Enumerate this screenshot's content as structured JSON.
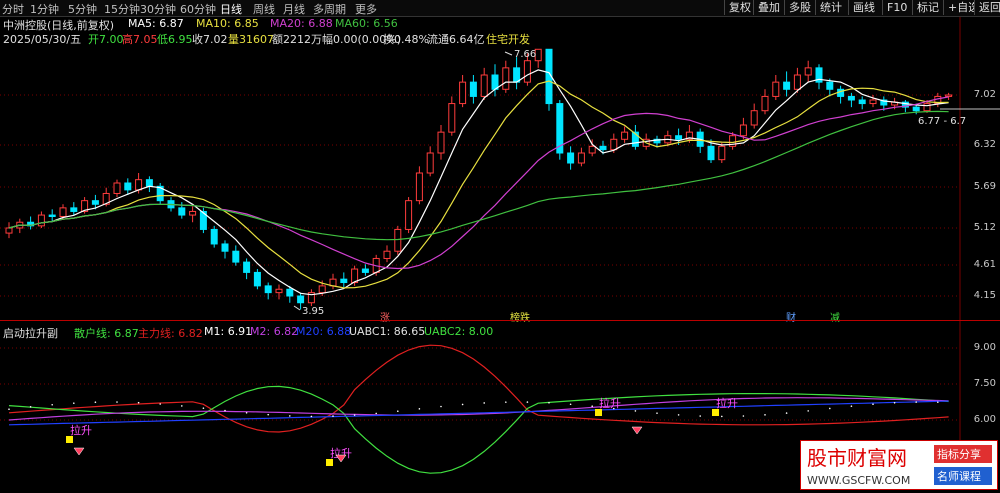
{
  "toolbar": {
    "tabs": [
      "分时",
      "1分钟",
      "5分钟",
      "15分钟",
      "30分钟",
      "60分钟",
      "日线",
      "周线",
      "月线",
      "多周期",
      "更多"
    ],
    "active": "日线",
    "right_buttons": [
      "复权",
      "叠加",
      "多股",
      "统计",
      "画线",
      "F10",
      "标记",
      "+自选",
      "返回"
    ]
  },
  "header": {
    "name": "中洲控股(日线,前复权)",
    "ma5": "MA5: 6.87",
    "ma10": "MA10: 6.85",
    "ma20": "MA20: 6.88",
    "ma60": "MA60: 6.56",
    "date": "2025/05/30/五",
    "open": "开7.00",
    "high": "高7.05",
    "low": "低6.95",
    "close": "收7.02",
    "vol": "量31607",
    "amt": "额2212万",
    "chg": "幅0.00(0.00%)",
    "turnover": "换0.48%",
    "float": "流通6.64亿",
    "sector": "住宅开发"
  },
  "indicator_header": {
    "name": "启动拉升副",
    "retail": "散户线: 6.87",
    "main": "主力线: 6.82",
    "m1": "M1: 6.91",
    "m2": "M2: 6.82",
    "m20": "M20: 6.88",
    "uabc1": "UABC1: 86.65",
    "uabc2": "UABC2: 8.00"
  },
  "colors": {
    "up": "#ff3c3c",
    "down": "#00e5ff",
    "ma5": "#ffffff",
    "ma10": "#e8e040",
    "ma20": "#d040d0",
    "ma60": "#40c040",
    "retail": "#40e040",
    "main": "#e02020",
    "m1": "#ffffff",
    "m2": "#c040e0",
    "m20": "#2040ff"
  },
  "chart_data": {
    "type": "candlestick",
    "price_axis": {
      "ticks": [
        "7.02",
        "6.32",
        "5.69",
        "5.12",
        "4.61",
        "4.15"
      ]
    },
    "indicator_axis": {
      "ticks": [
        "9.00",
        "7.50",
        "6.00"
      ]
    },
    "annotations": {
      "high": "7.66",
      "low": "3.95",
      "right_label": "6.77 - 6.7",
      "tag_zhang": "涨",
      "tag_bangdie": "榜跌",
      "tag_cai": "财",
      "tag_jian": "减",
      "lasheng": "拉升"
    },
    "candles": [
      [
        5.05,
        5.12,
        4.98,
        5.2
      ],
      [
        5.12,
        5.2,
        5.05,
        5.25
      ],
      [
        5.2,
        5.15,
        5.1,
        5.28
      ],
      [
        5.15,
        5.3,
        5.12,
        5.35
      ],
      [
        5.3,
        5.28,
        5.2,
        5.38
      ],
      [
        5.28,
        5.4,
        5.25,
        5.45
      ],
      [
        5.4,
        5.35,
        5.3,
        5.48
      ],
      [
        5.35,
        5.5,
        5.32,
        5.55
      ],
      [
        5.5,
        5.45,
        5.38,
        5.58
      ],
      [
        5.45,
        5.6,
        5.42,
        5.68
      ],
      [
        5.6,
        5.75,
        5.55,
        5.8
      ],
      [
        5.75,
        5.65,
        5.58,
        5.82
      ],
      [
        5.65,
        5.8,
        5.6,
        5.9
      ],
      [
        5.8,
        5.7,
        5.62,
        5.85
      ],
      [
        5.7,
        5.5,
        5.45,
        5.75
      ],
      [
        5.5,
        5.4,
        5.35,
        5.55
      ],
      [
        5.4,
        5.3,
        5.25,
        5.48
      ],
      [
        5.3,
        5.35,
        5.2,
        5.42
      ],
      [
        5.35,
        5.1,
        5.05,
        5.4
      ],
      [
        5.1,
        4.9,
        4.85,
        5.15
      ],
      [
        4.9,
        4.8,
        4.7,
        4.95
      ],
      [
        4.8,
        4.65,
        4.6,
        4.88
      ],
      [
        4.65,
        4.5,
        4.4,
        4.7
      ],
      [
        4.5,
        4.3,
        4.25,
        4.55
      ],
      [
        4.3,
        4.2,
        4.1,
        4.35
      ],
      [
        4.2,
        4.25,
        4.1,
        4.32
      ],
      [
        4.25,
        4.15,
        4.05,
        4.3
      ],
      [
        4.15,
        4.05,
        3.95,
        4.2
      ],
      [
        4.05,
        4.2,
        4.0,
        4.25
      ],
      [
        4.2,
        4.3,
        4.15,
        4.38
      ],
      [
        4.3,
        4.4,
        4.25,
        4.48
      ],
      [
        4.4,
        4.35,
        4.28,
        4.5
      ],
      [
        4.35,
        4.55,
        4.3,
        4.6
      ],
      [
        4.55,
        4.5,
        4.45,
        4.62
      ],
      [
        4.5,
        4.7,
        4.45,
        4.75
      ],
      [
        4.7,
        4.8,
        4.65,
        4.88
      ],
      [
        4.8,
        5.1,
        4.75,
        5.15
      ],
      [
        5.1,
        5.5,
        5.05,
        5.55
      ],
      [
        5.5,
        5.9,
        5.45,
        6.0
      ],
      [
        5.9,
        6.2,
        5.85,
        6.3
      ],
      [
        6.2,
        6.5,
        6.1,
        6.6
      ],
      [
        6.5,
        6.9,
        6.45,
        7.0
      ],
      [
        6.9,
        7.2,
        6.85,
        7.3
      ],
      [
        7.2,
        7.0,
        6.9,
        7.3
      ],
      [
        7.0,
        7.3,
        6.95,
        7.4
      ],
      [
        7.3,
        7.1,
        7.0,
        7.45
      ],
      [
        7.1,
        7.4,
        7.05,
        7.5
      ],
      [
        7.4,
        7.2,
        7.1,
        7.55
      ],
      [
        7.2,
        7.5,
        7.15,
        7.6
      ],
      [
        7.5,
        7.66,
        7.4,
        7.66
      ],
      [
        7.66,
        6.9,
        6.8,
        7.66
      ],
      [
        6.9,
        6.2,
        6.1,
        6.95
      ],
      [
        6.2,
        6.05,
        5.95,
        6.3
      ],
      [
        6.05,
        6.2,
        6.0,
        6.28
      ],
      [
        6.2,
        6.3,
        6.15,
        6.4
      ],
      [
        6.3,
        6.25,
        6.18,
        6.38
      ],
      [
        6.25,
        6.4,
        6.2,
        6.48
      ],
      [
        6.4,
        6.5,
        6.35,
        6.58
      ],
      [
        6.5,
        6.3,
        6.25,
        6.6
      ],
      [
        6.3,
        6.4,
        6.25,
        6.48
      ],
      [
        6.4,
        6.35,
        6.28,
        6.45
      ],
      [
        6.35,
        6.45,
        6.3,
        6.52
      ],
      [
        6.45,
        6.4,
        6.32,
        6.55
      ],
      [
        6.4,
        6.5,
        6.35,
        6.6
      ],
      [
        6.5,
        6.3,
        6.2,
        6.55
      ],
      [
        6.3,
        6.1,
        6.05,
        6.4
      ],
      [
        6.1,
        6.3,
        6.05,
        6.35
      ],
      [
        6.3,
        6.45,
        6.25,
        6.5
      ],
      [
        6.45,
        6.6,
        6.4,
        6.7
      ],
      [
        6.6,
        6.8,
        6.55,
        6.9
      ],
      [
        6.8,
        7.0,
        6.75,
        7.1
      ],
      [
        7.0,
        7.2,
        6.95,
        7.3
      ],
      [
        7.2,
        7.1,
        7.0,
        7.35
      ],
      [
        7.1,
        7.3,
        7.05,
        7.4
      ],
      [
        7.3,
        7.4,
        7.2,
        7.5
      ],
      [
        7.4,
        7.2,
        7.1,
        7.45
      ],
      [
        7.2,
        7.1,
        7.0,
        7.25
      ],
      [
        7.1,
        7.0,
        6.9,
        7.15
      ],
      [
        7.0,
        6.95,
        6.85,
        7.05
      ],
      [
        6.95,
        6.9,
        6.82,
        7.0
      ],
      [
        6.9,
        6.95,
        6.85,
        7.02
      ],
      [
        6.95,
        6.88,
        6.8,
        7.0
      ],
      [
        6.88,
        6.92,
        6.82,
        6.98
      ],
      [
        6.92,
        6.85,
        6.78,
        6.95
      ],
      [
        6.85,
        6.8,
        6.75,
        6.9
      ],
      [
        6.8,
        6.9,
        6.77,
        6.95
      ],
      [
        6.9,
        7.0,
        6.85,
        7.05
      ],
      [
        7.0,
        7.02,
        6.95,
        7.05
      ]
    ]
  }
}
